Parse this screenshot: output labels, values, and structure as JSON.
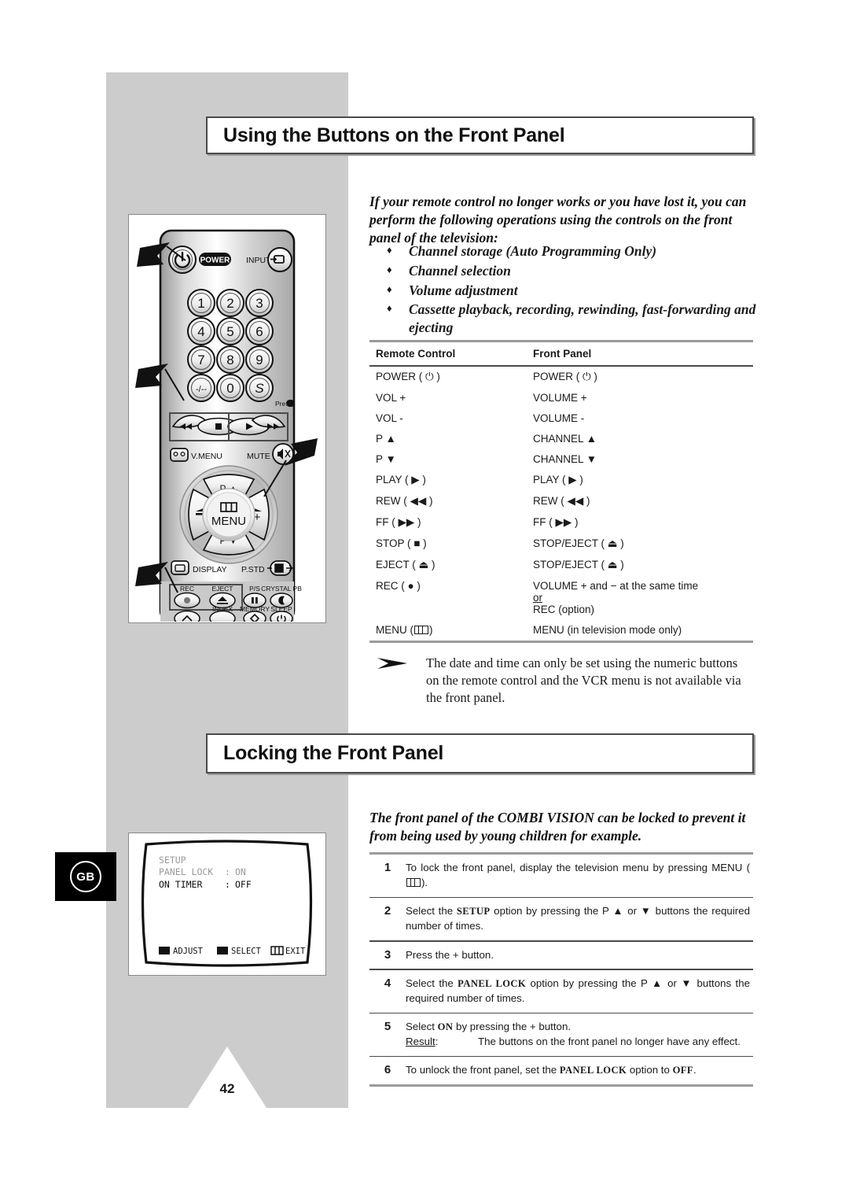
{
  "page": {
    "number": "42",
    "region_badge": "GB"
  },
  "sections": [
    {
      "id": "using-buttons",
      "title": "Using the Buttons on the Front Panel"
    },
    {
      "id": "locking-panel",
      "title": "Locking the Front Panel"
    }
  ],
  "intro_1": "If your remote control no longer works or you have lost it, you can perform the following operations using the controls on the front panel of the television:",
  "bullets": [
    "Channel storage (Auto Programming Only)",
    "Channel selection",
    "Volume adjustment",
    "Cassette playback, recording, rewinding, fast-forwarding and ejecting"
  ],
  "bullet_marker": "♦",
  "mapping_table": {
    "headers": {
      "left": "Remote Control",
      "right": "Front Panel"
    },
    "rows": [
      {
        "remote": "POWER ( ⏻ )",
        "front": "POWER ( ⏻ )"
      },
      {
        "remote": "VOL +",
        "front": "VOLUME +"
      },
      {
        "remote": "VOL -",
        "front": "VOLUME -"
      },
      {
        "remote": "P ▲",
        "front": "CHANNEL ▲"
      },
      {
        "remote": "P ▼",
        "front": "CHANNEL ▼"
      },
      {
        "remote": "PLAY ( ▶ )",
        "front": "PLAY ( ▶ )"
      },
      {
        "remote": "REW ( ◀◀ )",
        "front": "REW ( ◀◀ )"
      },
      {
        "remote": "FF ( ▶▶ )",
        "front": "FF ( ▶▶ )"
      },
      {
        "remote": "STOP ( ■ )",
        "front": "STOP/EJECT ( ⏏ )"
      },
      {
        "remote": "EJECT ( ⏏ )",
        "front": "STOP/EJECT ( ⏏ )"
      },
      {
        "remote": "REC ( ● )",
        "front": "VOLUME + and − at the same time",
        "front_extra": [
          "or",
          "REC (option)"
        ],
        "front_extra_underline": [
          true,
          false
        ]
      },
      {
        "remote": "MENU",
        "remote_has_menu_glyph": true,
        "front": "MENU (in television mode only)"
      }
    ]
  },
  "note": {
    "marker": "arrow-note-icon",
    "text": "The date and time can only be set using the numeric buttons on the remote control and the VCR menu is not available via the front panel."
  },
  "intro_2": "The front panel of the COMBI VISION can be locked to prevent it from being used by young children for example.",
  "steps": [
    {
      "num": "1",
      "parts": [
        {
          "t": "To lock the front panel, display the television menu by pressing MENU ("
        },
        {
          "t": "",
          "glyph": "menu-glyph"
        },
        {
          "t": ")."
        }
      ]
    },
    {
      "num": "2",
      "parts": [
        {
          "t": "Select the "
        },
        {
          "t": "SETUP",
          "mono": true
        },
        {
          "t": " option by pressing the P ▲ or ▼ buttons the required number of times."
        }
      ]
    },
    {
      "num": "3",
      "parts": [
        {
          "t": "Press the + button."
        }
      ]
    },
    {
      "num": "4",
      "parts": [
        {
          "t": "Select the "
        },
        {
          "t": "PANEL LOCK",
          "mono": true
        },
        {
          "t": " option by pressing the P ▲ or ▼ buttons the required number of times."
        }
      ]
    },
    {
      "num": "5",
      "parts": [
        {
          "t": "Select "
        },
        {
          "t": "ON",
          "mono": true
        },
        {
          "t": " by pressing the + button."
        }
      ],
      "result_label": "Result",
      "result_text": "The buttons on the front panel no longer have any effect."
    },
    {
      "num": "6",
      "parts": [
        {
          "t": "To unlock the front panel, set the "
        },
        {
          "t": "PANEL LOCK",
          "mono": true
        },
        {
          "t": " option to "
        },
        {
          "t": "OFF",
          "mono": true
        },
        {
          "t": "."
        }
      ]
    }
  ],
  "remote_figure": {
    "name": "remote-control-illustration",
    "labels": {
      "power": "POWER",
      "input": "INPUT",
      "keypad": [
        "1",
        "2",
        "3",
        "4",
        "5",
        "6",
        "7",
        "8",
        "9",
        "-/--",
        "0",
        "S"
      ],
      "pre": "Pre.",
      "vmenu": "V.MENU",
      "mute": "MUTE",
      "p_up": "P ▲",
      "p_down": "P ▼",
      "menu": "MENU",
      "vol_minus": "−",
      "vol_plus": "+",
      "display": "DISPLAY",
      "pstd": "P.STD",
      "rec": "REC",
      "eject": "EJECT",
      "ps": "P/S",
      "crystal_pb": "CRYSTAL PB",
      "index": "INDEX",
      "memory": "MEMORY",
      "sleep": "SLEEP"
    }
  },
  "osd_figure": {
    "name": "tv-setup-menu-illustration",
    "title": "SETUP",
    "rows": [
      {
        "label": "PANEL LOCK",
        "sep": ":",
        "value": "ON",
        "dim": true
      },
      {
        "label": "ON TIMER",
        "sep": ":",
        "value": "OFF",
        "dim": false
      }
    ],
    "footer": [
      {
        "icon": "adjust-icon",
        "label": "ADJUST"
      },
      {
        "icon": "select-icon",
        "label": "SELECT"
      },
      {
        "icon": "exit-menu-icon",
        "label": "EXIT"
      }
    ]
  },
  "colors": {
    "panel_gray": "#cccccc",
    "rule_thick": "#9a9a9a",
    "rule_thin": "#4a4a4a",
    "text": "#1a1a1a",
    "badge_bg": "#000000"
  }
}
